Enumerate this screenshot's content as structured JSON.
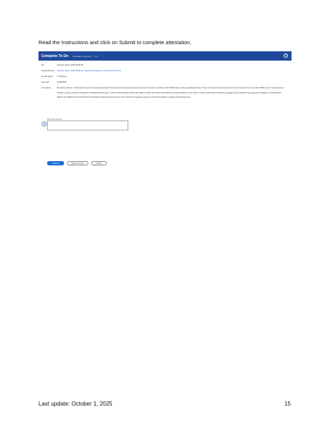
{
  "heading": "Read the Instructions and click on Submit to complete attestation.",
  "panel": {
    "title": "Complete To Do",
    "subtitle": "Attestation required",
    "count": "1/1",
    "help_icon": "help-icon",
    "fields": [
      {
        "label": "For",
        "value": "Expense Report: EXR-0009718",
        "link": false
      },
      {
        "label": "Overall Process",
        "value": "Expense Report: EXR-0009718 - Attestation Required on 07/11/2025 09:14:19",
        "link": true
      },
      {
        "label": "Overall Status",
        "value": "In Progress",
        "link": false
      },
      {
        "label": "Due Date",
        "value": "07/22/2025",
        "link": false
      }
    ],
    "instructions_label": "Instructions",
    "instructions": [
      "By clicking Submit, I certify that this report accurately describes the actual and necessary business expenses incurred in compliance with WGB policies unless specifically noted. I have not received reimbursement for these expenses from any other WGB entity or outside source.",
      "If airfare expense has been charged to a federally funded grant, I further certify that best airfare was made to obtain the lowest reasonable commercial airfare for each travel. I further certify that no alcoholic beverages were included in any expenses charged to a federal grant.",
      "Please see WGB Policy and Procedure for Employee Business Expenses for more information regarding expenses and documentation regarding Special Approval."
    ],
    "comment_label": "enter your comment",
    "avatar_text": "AB",
    "buttons": {
      "submit": "Submit",
      "save": "Save for Later",
      "close": "Close"
    }
  },
  "footer": {
    "last_update": "Last update:  October 1, 2025",
    "page_number": "15"
  },
  "colors": {
    "titlebar": "#1f4a9a",
    "link": "#1d62c5",
    "primary_button": "#1f6fd0"
  }
}
